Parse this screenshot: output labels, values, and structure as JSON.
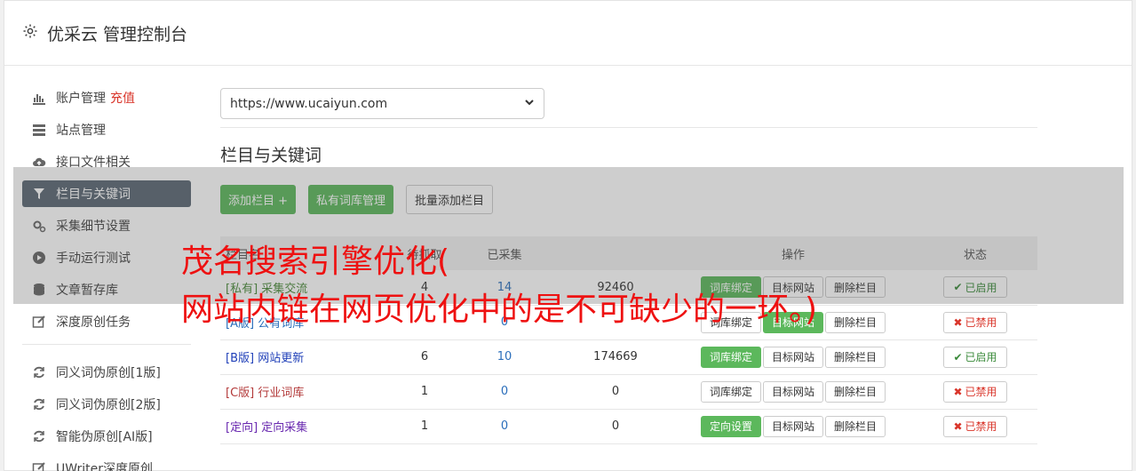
{
  "header": {
    "title": "优采云 管理控制台",
    "icon": "gear-icon"
  },
  "sidebar": {
    "items": [
      {
        "label": "账户管理",
        "extra": "充值",
        "icon": "bar-chart-icon"
      },
      {
        "label": "站点管理",
        "icon": "server-icon"
      },
      {
        "label": "接口文件相关",
        "icon": "cloud-upload-icon"
      },
      {
        "label": "栏目与关键词",
        "icon": "filter-icon",
        "active": true
      },
      {
        "label": "采集细节设置",
        "icon": "gears-icon"
      },
      {
        "label": "手动运行测试",
        "icon": "play-circle-icon"
      },
      {
        "label": "文章暂存库",
        "icon": "database-icon"
      },
      {
        "label": "深度原创任务",
        "icon": "edit-icon"
      }
    ],
    "items2": [
      {
        "label": "同义词伪原创[1版]",
        "icon": "refresh-icon"
      },
      {
        "label": "同义词伪原创[2版]",
        "icon": "refresh-icon"
      },
      {
        "label": "智能伪原创[AI版]",
        "icon": "refresh-icon"
      },
      {
        "label": "UWriter深度原创",
        "icon": "edit-icon"
      }
    ]
  },
  "main": {
    "site_select": "https://www.ucaiyun.com",
    "section_title": "栏目与关键词",
    "buttons": {
      "add": "添加栏目 +",
      "private": "私有词库管理",
      "batch": "批量添加栏目"
    },
    "table": {
      "headers": [
        "栏目名",
        "待抓取",
        "已采集",
        "操作",
        "状态"
      ],
      "rows": [
        {
          "tag": "[私有]",
          "name": "采集交流",
          "tag_color": "#4a8a3a",
          "a": "4",
          "b": "14",
          "c": "92460",
          "op1": "词库绑定",
          "op1_green": true,
          "op2": "目标网站",
          "op2_green": false,
          "op3": "删除栏目",
          "status": "已启用",
          "status_mark": "✔",
          "status_color": "#3a8a3a"
        },
        {
          "tag": "[A版]",
          "name": "公有词库",
          "tag_color": "#2a6ebb",
          "a": "",
          "b": "0",
          "c": "",
          "op1": "词库绑定",
          "op1_green": false,
          "op2": "目标网站",
          "op2_green": true,
          "op3": "删除栏目",
          "status": "已禁用",
          "status_mark": "✖",
          "status_color": "#d9352a"
        },
        {
          "tag": "[B版]",
          "name": "网站更新",
          "tag_color": "#1f3fb8",
          "a": "6",
          "b": "10",
          "c": "174669",
          "op1": "词库绑定",
          "op1_green": true,
          "op2": "目标网站",
          "op2_green": false,
          "op3": "删除栏目",
          "status": "已启用",
          "status_mark": "✔",
          "status_color": "#3a8a3a"
        },
        {
          "tag": "[C版]",
          "name": "行业词库",
          "tag_color": "#b33a3a",
          "a": "1",
          "b": "0",
          "c": "0",
          "op1": "词库绑定",
          "op1_green": false,
          "op2": "目标网站",
          "op2_green": false,
          "op3": "删除栏目",
          "status": "已禁用",
          "status_mark": "✖",
          "status_color": "#d9352a"
        },
        {
          "tag": "[定向]",
          "name": "定向采集",
          "tag_color": "#6a2ab0",
          "a": "1",
          "b": "0",
          "c": "0",
          "op1": "定向设置",
          "op1_green": true,
          "op2": "目标网站",
          "op2_green": false,
          "op3": "删除栏目",
          "status": "已禁用",
          "status_mark": "✖",
          "status_color": "#d9352a"
        }
      ]
    }
  },
  "overlay": {
    "line1": "茂名搜索引擎优化(",
    "line2": "网站内链在网页优化中的是不可缺少的一环。)"
  },
  "colors": {
    "accent_green": "#5cb85c",
    "active_bg": "#5b6774",
    "overlay_text": "#ee1111"
  }
}
